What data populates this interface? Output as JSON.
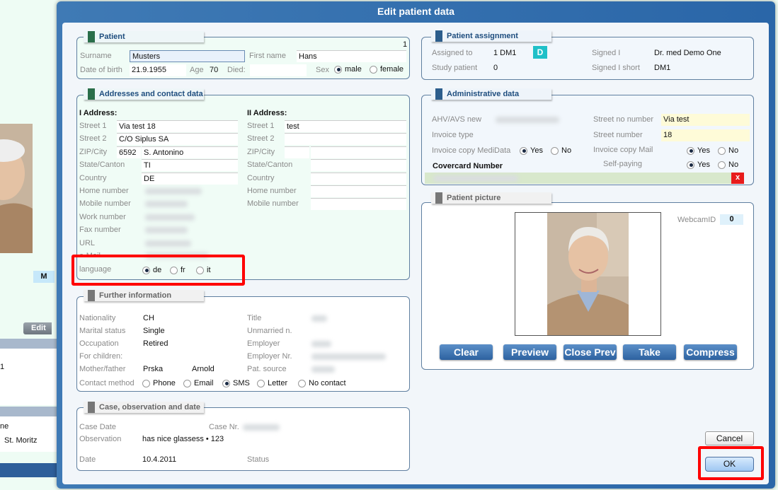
{
  "background": {
    "badge": "M",
    "edit_button": "Edit",
    "list_item_1": "1",
    "list_item_2": "ne",
    "list_item_3": "St. Moritz"
  },
  "dialog": {
    "title": "Edit patient data"
  },
  "patient": {
    "header": "Patient",
    "record_number": "1",
    "surname_label": "Surname",
    "surname": "Musters",
    "first_name_label": "First name",
    "first_name": "Hans",
    "dob_label": "Date of birth",
    "dob": "21.9.1955",
    "age_label": "Age",
    "age": "70",
    "died_label": "Died:",
    "sex_label": "Sex",
    "sex_options": [
      "male",
      "female"
    ],
    "sex_selected": "male"
  },
  "addresses": {
    "header": "Addresses and contact data",
    "first": {
      "title": "I Address:",
      "street1_label": "Street 1",
      "street1": "Via test 18",
      "street2_label": "Street 2",
      "street2": "C/O Siplus SA",
      "zip_label": "ZIP/City",
      "zip": "6592",
      "city": "S. Antonino",
      "state_label": "State/Canton",
      "state": "TI",
      "country_label": "Country",
      "country": "DE",
      "home_label": "Home number",
      "mobile_label": "Mobile number",
      "work_label": "Work number",
      "fax_label": "Fax number",
      "url_label": "URL",
      "email_label": "e-Mail"
    },
    "second": {
      "title": "II Address:",
      "street1_label": "Street 1",
      "street1": "test",
      "street2_label": "Street 2",
      "zip_label": "ZIP/City",
      "state_label": "State/Canton",
      "country_label": "Country",
      "home_label": "Home number",
      "mobile_label": "Mobile number"
    },
    "language_label": "language",
    "language_options": [
      "de",
      "fr",
      "it"
    ],
    "language_selected": "de"
  },
  "further": {
    "header": "Further information",
    "nationality_label": "Nationality",
    "nationality": "CH",
    "marital_label": "Marital status",
    "marital": "Single",
    "occupation_label": "Occupation",
    "occupation": "Retired",
    "children_label": "For children:",
    "parents_label": "Mother/father",
    "mother": "Prska",
    "father": "Arnold",
    "title_label": "Title",
    "unmarried_label": "Unmarried n.",
    "employer_label": "Employer",
    "employer_nr_label": "Employer Nr.",
    "source_label": "Pat. source",
    "contact_label": "Contact method",
    "contact_options": [
      "Phone",
      "Email",
      "SMS",
      "Letter",
      "No contact"
    ],
    "contact_selected": "SMS"
  },
  "case": {
    "header": "Case, observation and date",
    "case_date_label": "Case Date",
    "case_nr_label": "Case Nr.",
    "observation_label": "Observation",
    "observation": "has nice glassess • 123",
    "date_label": "Date",
    "date": "10.4.2011",
    "status_label": "Status"
  },
  "assignment": {
    "header": "Patient assignment",
    "assigned_label": "Assigned to",
    "assigned": "1 DM1",
    "badge": "D",
    "study_label": "Study patient",
    "study": "0",
    "signed_label": "Signed I",
    "signed": "Dr. med Demo One",
    "signed_short_label": "Signed I short",
    "signed_short": "DM1"
  },
  "admin": {
    "header": "Administrative data",
    "ahv_label": "AHV/AVS new",
    "invoice_type_label": "Invoice type",
    "medidata_label": "Invoice copy MediData",
    "street_no_number_label": "Street no number",
    "street_no_number": "Via test",
    "street_number_label": "Street number",
    "street_number": "18",
    "mail_label": "Invoice copy Mail",
    "self_paying_label": "Self-paying",
    "covercard_label": "Covercard Number",
    "clear_x": "x",
    "yes": "Yes",
    "no": "No"
  },
  "picture": {
    "header": "Patient picture",
    "webcam_label": "WebcamID",
    "webcam_id": "0",
    "buttons": [
      "Clear",
      "Preview",
      "Close Prev",
      "Take",
      "Compress"
    ]
  },
  "footer": {
    "cancel": "Cancel",
    "ok": "OK"
  },
  "colors": {
    "title_bar": "#2a66a8",
    "highlight": "#ff0000",
    "yellow_field": "#fefbd8",
    "covercard_field": "#d8e8cc"
  }
}
